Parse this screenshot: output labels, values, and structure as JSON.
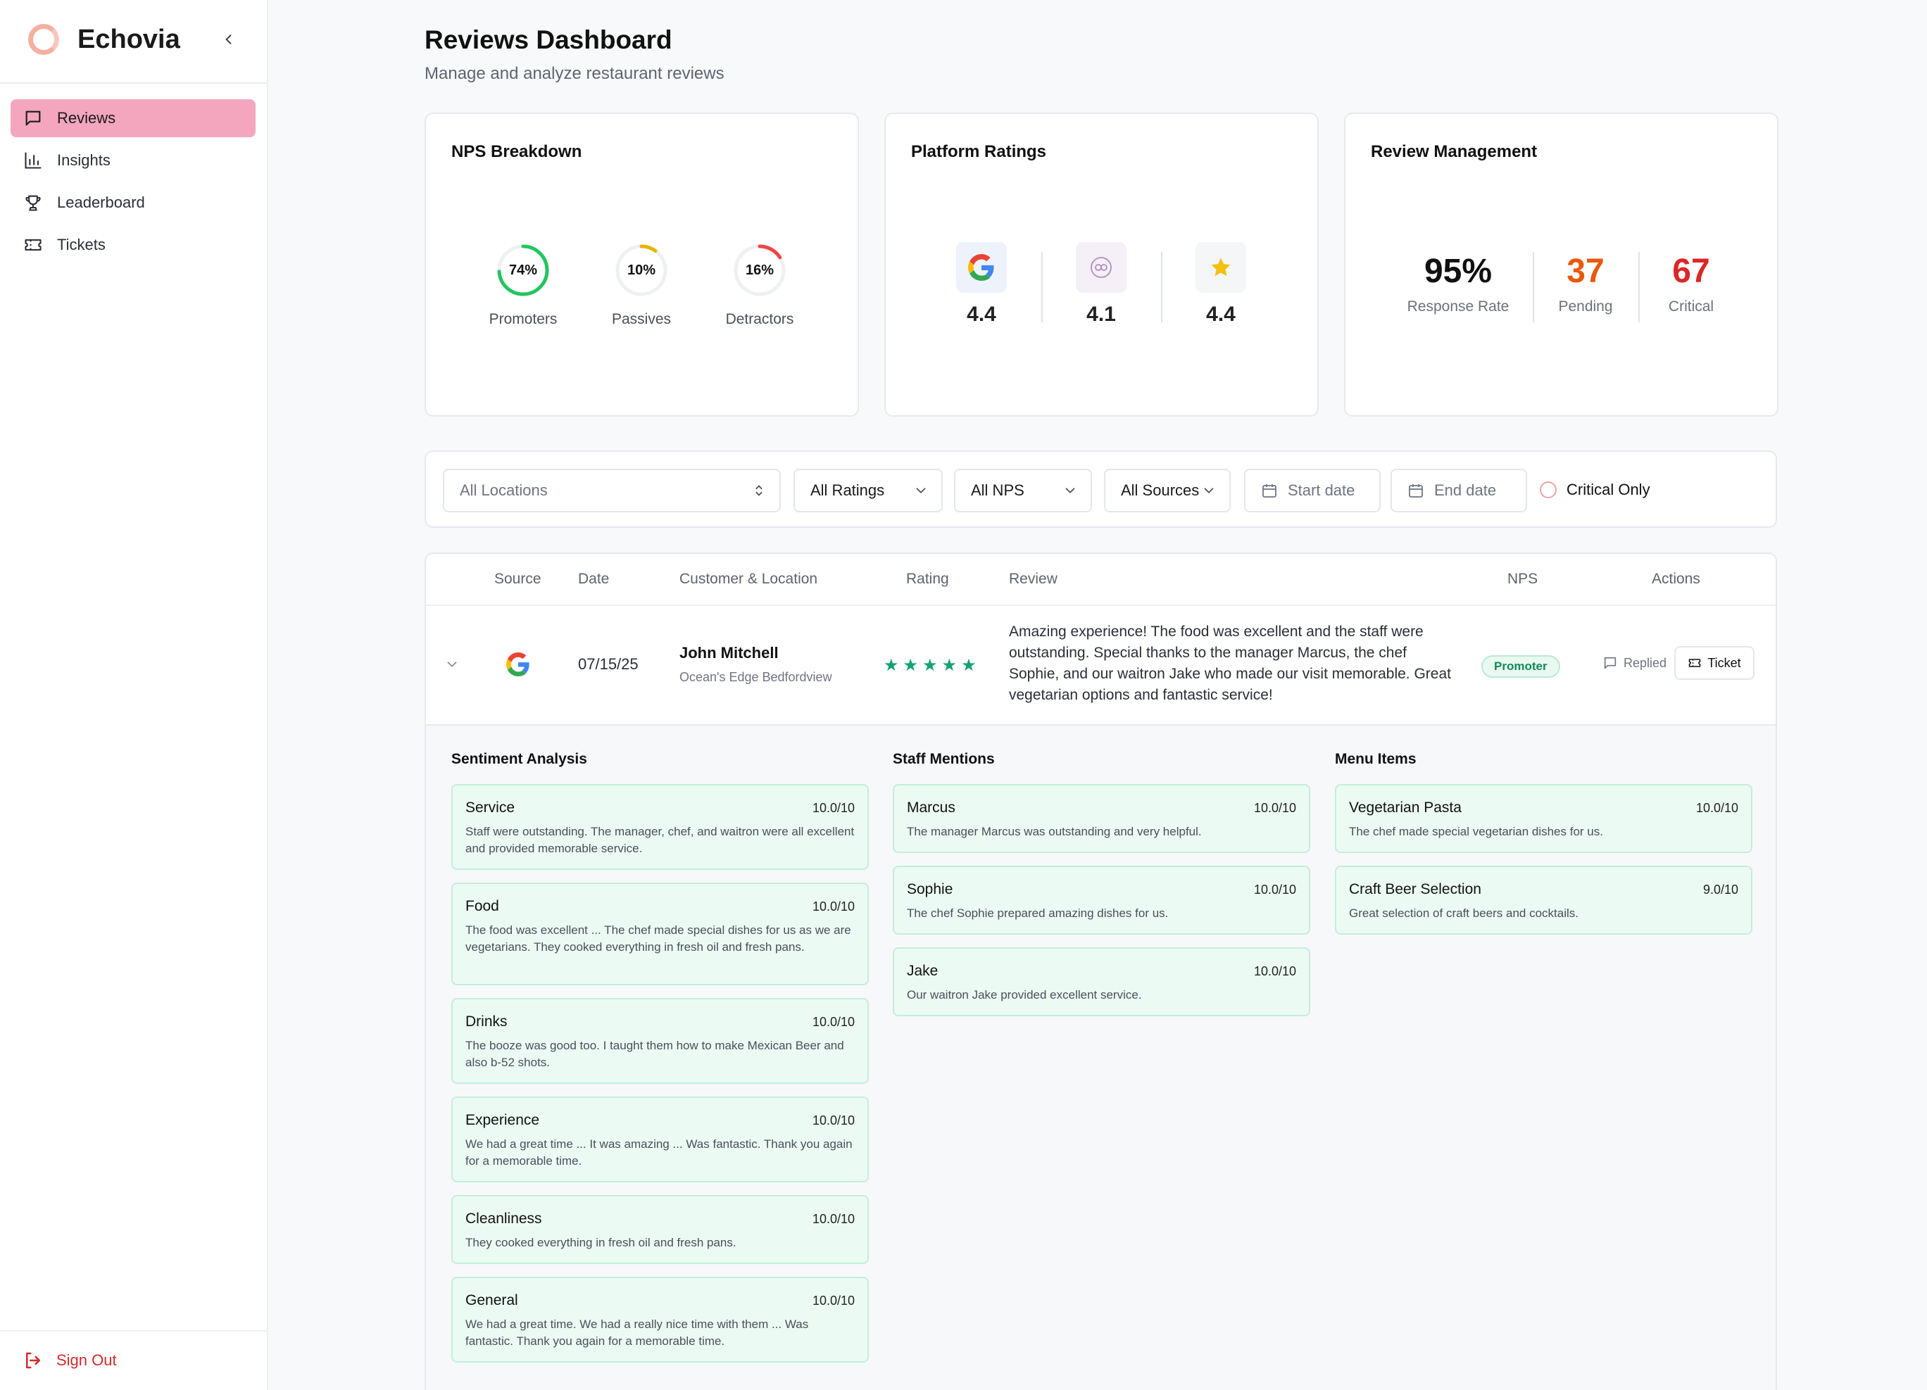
{
  "app": {
    "name": "Echovia"
  },
  "sidebar": {
    "items": [
      {
        "label": "Reviews",
        "icon": "message-square-icon",
        "active": true
      },
      {
        "label": "Insights",
        "icon": "bar-chart-icon"
      },
      {
        "label": "Leaderboard",
        "icon": "trophy-icon"
      },
      {
        "label": "Tickets",
        "icon": "ticket-icon"
      }
    ],
    "sign_out": "Sign Out"
  },
  "header": {
    "title": "Reviews Dashboard",
    "subtitle": "Manage and analyze restaurant reviews"
  },
  "nps": {
    "title": "NPS Breakdown",
    "items": [
      {
        "value": "74%",
        "fraction": 0.74,
        "label": "Promoters",
        "color": "#22c55e"
      },
      {
        "value": "10%",
        "fraction": 0.1,
        "label": "Passives",
        "color": "#eab308"
      },
      {
        "value": "16%",
        "fraction": 0.16,
        "label": "Detractors",
        "color": "#ef4444"
      }
    ]
  },
  "platforms": {
    "title": "Platform Ratings",
    "items": [
      {
        "icon": "google-icon",
        "rating": "4.4"
      },
      {
        "icon": "dineplan-icon",
        "rating": "4.1"
      },
      {
        "icon": "star-icon",
        "rating": "4.4"
      }
    ]
  },
  "management": {
    "title": "Review Management",
    "items": [
      {
        "value": "95%",
        "label": "Response Rate",
        "color": "#111111"
      },
      {
        "value": "37",
        "label": "Pending",
        "color": "#ea580c"
      },
      {
        "value": "67",
        "label": "Critical",
        "color": "#dc2626"
      }
    ]
  },
  "filters": {
    "locations": "All Locations",
    "ratings": "All Ratings",
    "nps": "All NPS",
    "sources": "All Sources",
    "start_date": "Start date",
    "end_date": "End date",
    "critical_only": "Critical Only"
  },
  "table": {
    "headers": {
      "source": "Source",
      "date": "Date",
      "customer": "Customer & Location",
      "rating": "Rating",
      "review": "Review",
      "nps": "NPS",
      "actions": "Actions"
    },
    "row": {
      "source_icon": "google-icon",
      "date": "07/15/25",
      "customer": "John Mitchell",
      "location": "Ocean's Edge Bedfordview",
      "rating": 5,
      "review": "Amazing experience! The food was excellent and the staff were outstanding. Special thanks to the manager Marcus, the chef Sophie, and our waitron Jake who made our visit memorable. Great vegetarian options and fantastic service!",
      "nps": "Promoter",
      "replied": "Replied",
      "ticket": "Ticket"
    }
  },
  "details": {
    "sentiment": {
      "title": "Sentiment Analysis",
      "items": [
        {
          "name": "Service",
          "score": "10.0/10",
          "text": "Staff were outstanding. The manager, chef, and waitron were all excellent and provided memorable service."
        },
        {
          "name": "Food",
          "score": "10.0/10",
          "text": "The food was excellent ... The chef made special dishes for us as we are vegetarians. They cooked everything in fresh oil and fresh pans."
        },
        {
          "name": "Drinks",
          "score": "10.0/10",
          "text": "The booze was good too. I taught them how to make Mexican Beer and also b-52 shots."
        },
        {
          "name": "Experience",
          "score": "10.0/10",
          "text": "We had a great time ... It was amazing ... Was fantastic. Thank you again for a memorable time."
        },
        {
          "name": "Cleanliness",
          "score": "10.0/10",
          "text": "They cooked everything in fresh oil and fresh pans."
        },
        {
          "name": "General",
          "score": "10.0/10",
          "text": "We had a great time. We had a really nice time with them ... Was fantastic. Thank you again for a memorable time."
        }
      ]
    },
    "staff": {
      "title": "Staff Mentions",
      "items": [
        {
          "name": "Marcus",
          "score": "10.0/10",
          "text": "The manager Marcus was outstanding and very helpful."
        },
        {
          "name": "Sophie",
          "score": "10.0/10",
          "text": "The chef Sophie prepared amazing dishes for us."
        },
        {
          "name": "Jake",
          "score": "10.0/10",
          "text": "Our waitron Jake provided excellent service."
        }
      ]
    },
    "menu": {
      "title": "Menu Items",
      "items": [
        {
          "name": "Vegetarian Pasta",
          "score": "10.0/10",
          "text": "The chef made special vegetarian dishes for us."
        },
        {
          "name": "Craft Beer Selection",
          "score": "9.0/10",
          "text": "Great selection of craft beers and cocktails."
        }
      ]
    }
  }
}
